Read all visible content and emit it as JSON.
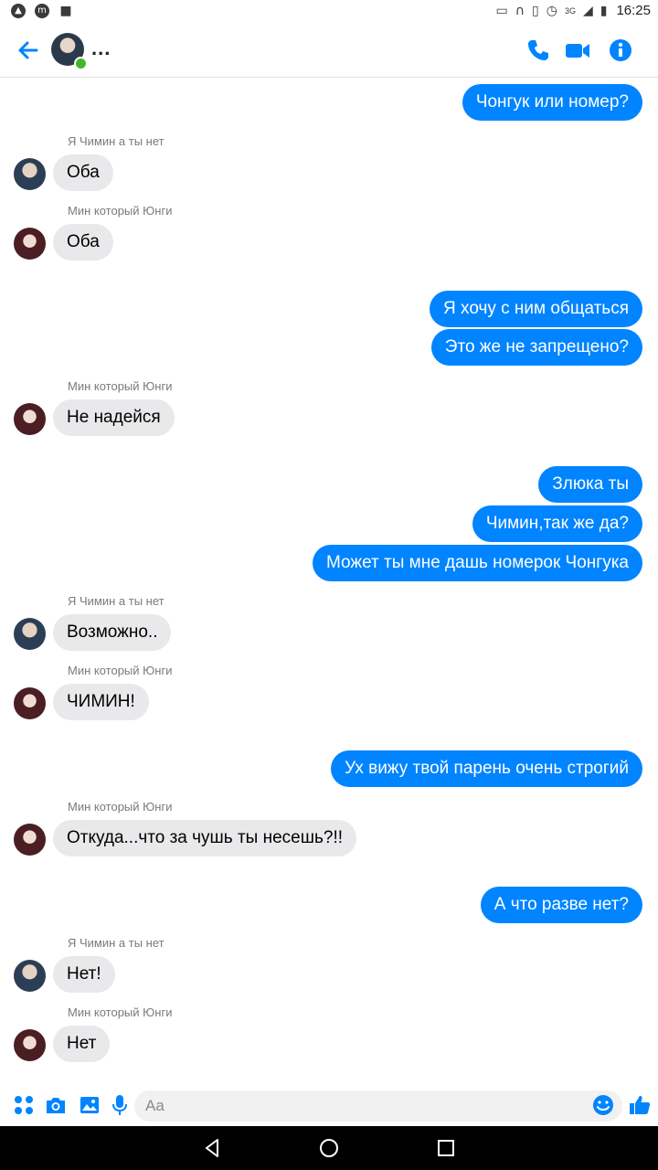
{
  "status_bar": {
    "time": "16:25",
    "network": "3G",
    "left_icons": [
      "app-a-icon",
      "app-m-icon",
      "lock-icon"
    ],
    "right_icons": [
      "cast-icon",
      "headset-icon",
      "vibrate-icon",
      "alarm-icon",
      "signal-icon",
      "battery-icon"
    ]
  },
  "header": {
    "title": "...",
    "online": true,
    "icons": [
      "back-arrow-icon",
      "phone-icon",
      "video-icon",
      "info-icon"
    ],
    "accent_color": "#0084ff"
  },
  "messages": [
    {
      "side": "out",
      "text": "Чонгук или номер?"
    },
    {
      "side": "in",
      "sender": "Я Чимин а ты нет",
      "text": "Оба"
    },
    {
      "side": "in",
      "sender": "Мин который Юнги",
      "text": "Оба"
    },
    {
      "side": "out",
      "text": "Я хочу с ним общаться"
    },
    {
      "side": "out",
      "text": "Это же не запрещено?"
    },
    {
      "side": "in",
      "sender": "Мин который Юнги",
      "text": "Не надейся"
    },
    {
      "side": "out",
      "text": "Злюка ты"
    },
    {
      "side": "out",
      "text": "Чимин,так же да?"
    },
    {
      "side": "out",
      "text": "Может ты мне дашь номерок Чонгука"
    },
    {
      "side": "in",
      "sender": "Я Чимин а ты нет",
      "text": "Возможно.."
    },
    {
      "side": "in",
      "sender": "Мин который Юнги",
      "text": "ЧИМИН!"
    },
    {
      "side": "out",
      "text": "Ух вижу твой парень очень строгий"
    },
    {
      "side": "in",
      "sender": "Мин который Юнги",
      "text": "Откуда...что за чушь ты несешь?!!"
    },
    {
      "side": "out",
      "text": "А что разве нет?"
    },
    {
      "side": "in",
      "sender": "Я Чимин а ты нет",
      "text": "Нет!"
    },
    {
      "side": "in",
      "sender": "Мин который Юнги",
      "text": "Нет"
    }
  ],
  "composer": {
    "placeholder": "Aa",
    "icons": [
      "apps-icon",
      "camera-icon",
      "gallery-icon",
      "mic-icon",
      "emoji-icon",
      "like-icon"
    ]
  },
  "navbar": {
    "icons": [
      "back-nav-icon",
      "home-nav-icon",
      "recents-nav-icon"
    ]
  }
}
